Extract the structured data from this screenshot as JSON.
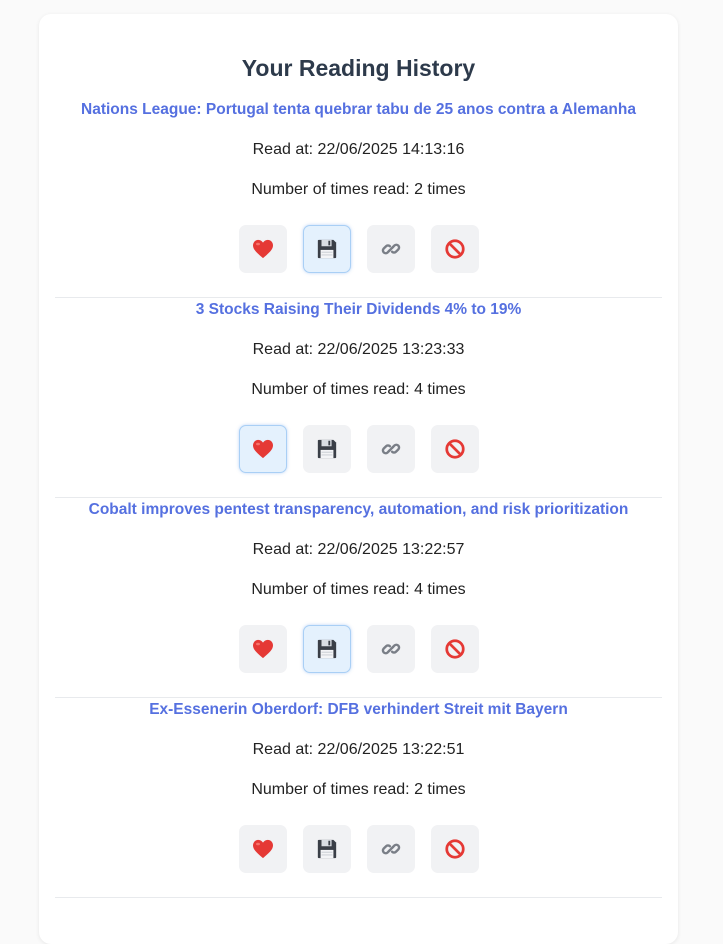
{
  "page": {
    "title": "Your Reading History"
  },
  "labels": {
    "read_at_prefix": "Read at: ",
    "times_prefix": "Number of times read: "
  },
  "icons": {
    "like": "heart-icon",
    "save": "floppy-disk-icon",
    "share": "link-icon",
    "block": "no-entry-icon"
  },
  "colors": {
    "title_link": "#5570e0",
    "heart": "#e53935",
    "active_bg": "#e4f1fd",
    "active_border": "#a9cff5"
  },
  "entries": [
    {
      "title": "Nations League: Portugal tenta quebrar tabu de 25 anos contra a Alemanha",
      "read_at": "Read at: 22/06/2025 14:13:16",
      "times": "Number of times read: 2 times",
      "liked": false,
      "saved": true
    },
    {
      "title": "3 Stocks Raising Their Dividends 4% to 19%",
      "read_at": "Read at: 22/06/2025 13:23:33",
      "times": "Number of times read: 4 times",
      "liked": true,
      "saved": false
    },
    {
      "title": "Cobalt improves pentest transparency, automation, and risk prioritization",
      "read_at": "Read at: 22/06/2025 13:22:57",
      "times": "Number of times read: 4 times",
      "liked": false,
      "saved": true
    },
    {
      "title": "Ex-Essenerin Oberdorf: DFB verhindert Streit mit Bayern",
      "read_at": "Read at: 22/06/2025 13:22:51",
      "times": "Number of times read: 2 times",
      "liked": false,
      "saved": false
    }
  ]
}
